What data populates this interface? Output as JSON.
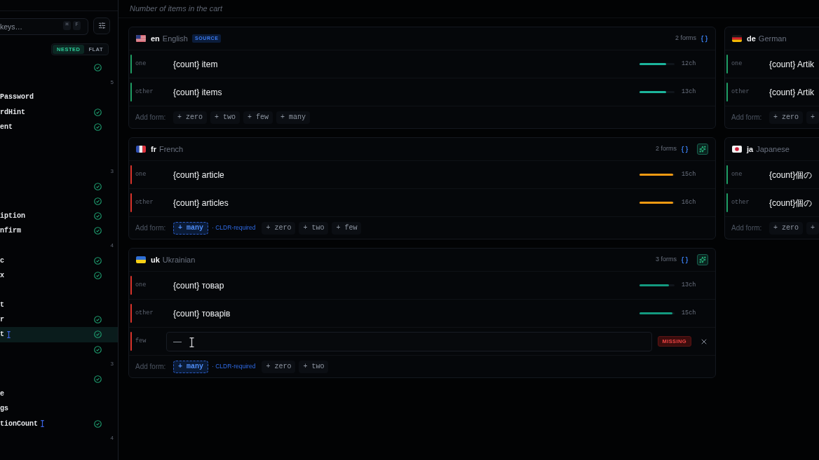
{
  "sidebar": {
    "search": {
      "placeholder": "keys…",
      "shortcut": [
        "⌘",
        "F"
      ]
    },
    "view_toggle": [
      {
        "label": "NESTED",
        "selected": true
      },
      {
        "label": "FLAT",
        "selected": false
      }
    ],
    "rows": [
      {
        "kind": "item",
        "selected": false,
        "translated": true
      },
      {
        "kind": "item",
        "count": "5",
        "selected": false,
        "translated": false
      },
      {
        "kind": "item",
        "label": "Password",
        "selected": false,
        "translated": false
      },
      {
        "kind": "item",
        "label": "rdHint",
        "selected": false,
        "translated": true
      },
      {
        "kind": "item",
        "label": "ent",
        "selected": false,
        "translated": true
      },
      {
        "kind": "blank"
      },
      {
        "kind": "blank"
      },
      {
        "kind": "item",
        "count": "3",
        "selected": false,
        "translated": false
      },
      {
        "kind": "item",
        "selected": false,
        "translated": true
      },
      {
        "kind": "item",
        "selected": false,
        "translated": true
      },
      {
        "kind": "item",
        "label": "iption",
        "selected": false,
        "translated": true
      },
      {
        "kind": "item",
        "label": "nfirm",
        "selected": false,
        "translated": true
      },
      {
        "kind": "item",
        "count": "4",
        "selected": false,
        "translated": false
      },
      {
        "kind": "item",
        "label": "c",
        "selected": false,
        "translated": true
      },
      {
        "kind": "item",
        "label": "x",
        "selected": false,
        "translated": true
      },
      {
        "kind": "blank"
      },
      {
        "kind": "item",
        "label": "t",
        "selected": false,
        "translated": false
      },
      {
        "kind": "item",
        "label": "r",
        "selected": false,
        "translated": true
      },
      {
        "kind": "item",
        "label": "t",
        "marker": true,
        "selected": true,
        "translated": true
      },
      {
        "kind": "item",
        "selected": false,
        "translated": true
      },
      {
        "kind": "item",
        "count": "3",
        "selected": false,
        "translated": false
      },
      {
        "kind": "item",
        "selected": false,
        "translated": true
      },
      {
        "kind": "item",
        "label": "e",
        "selected": false,
        "translated": false
      },
      {
        "kind": "item",
        "label": "gs",
        "selected": false,
        "translated": false
      },
      {
        "kind": "item",
        "label": "tionCount",
        "marker": true,
        "selected": false,
        "translated": true
      },
      {
        "kind": "item",
        "count": "4",
        "selected": false,
        "translated": false
      }
    ]
  },
  "description": "Number of items in the cart",
  "main_locales": [
    {
      "flag": {
        "kind": "us"
      },
      "code": "en",
      "name": "English",
      "badge": "SOURCE",
      "form_count": "2 forms",
      "ai_button": false,
      "complete": true,
      "forms": [
        {
          "kind": "filled",
          "label": "one",
          "value": "{count} item",
          "meter": {
            "level": 0.76,
            "color": "#1cb59c"
          },
          "length": "12ch"
        },
        {
          "kind": "filled",
          "label": "other",
          "value": "{count} items",
          "meter": {
            "level": 0.76,
            "color": "#1cb59c"
          },
          "length": "13ch"
        }
      ],
      "add_form": {
        "label": "Add form:",
        "options": [
          {
            "label": "+ zero",
            "required": false
          },
          {
            "label": "+ two",
            "required": false
          },
          {
            "label": "+ few",
            "required": false
          },
          {
            "label": "+ many",
            "required": false
          }
        ]
      }
    },
    {
      "flag": {
        "kind": "fr"
      },
      "code": "fr",
      "name": "French",
      "form_count": "2 forms",
      "ai_button": true,
      "complete": false,
      "forms": [
        {
          "kind": "filled",
          "label": "one",
          "value": "{count} article",
          "meter": {
            "level": 0.96,
            "color": "#f29a12"
          },
          "length": "15ch"
        },
        {
          "kind": "filled",
          "label": "other",
          "value": "{count} articles",
          "meter": {
            "level": 0.96,
            "color": "#f29a12"
          },
          "length": "16ch"
        }
      ],
      "add_form": {
        "label": "Add form:",
        "options": [
          {
            "label": "+ many",
            "required": true,
            "note": "· CLDR-required"
          },
          {
            "label": "+ zero",
            "required": false
          },
          {
            "label": "+ two",
            "required": false
          },
          {
            "label": "+ few",
            "required": false
          }
        ]
      }
    },
    {
      "flag": {
        "kind": "ua"
      },
      "code": "uk",
      "name": "Ukrainian",
      "form_count": "3 forms",
      "ai_button": true,
      "complete": false,
      "forms": [
        {
          "kind": "filled",
          "label": "one",
          "value": "{count} товар",
          "meter": {
            "level": 0.84,
            "color": "#13997f"
          },
          "length": "13ch"
        },
        {
          "kind": "filled",
          "label": "other",
          "value": "{count} товарів",
          "meter": {
            "level": 0.94,
            "color": "#13997f"
          },
          "length": "15ch"
        },
        {
          "kind": "missing",
          "label": "few",
          "placeholder": "—",
          "badge": "MISSING"
        }
      ],
      "add_form": {
        "label": "Add form:",
        "options": [
          {
            "label": "+ many",
            "required": true,
            "note": "· CLDR-required"
          },
          {
            "label": "+ zero",
            "required": false
          },
          {
            "label": "+ two",
            "required": false
          }
        ]
      }
    }
  ],
  "side_locales": [
    {
      "flag": {
        "kind": "de"
      },
      "code": "de",
      "name": "German",
      "ai_button": false,
      "complete": true,
      "forms": [
        {
          "kind": "filled",
          "label": "one",
          "value": "{count} Artik"
        },
        {
          "kind": "filled",
          "label": "other",
          "value": "{count} Artik"
        }
      ],
      "add_form": {
        "label": "Add form:",
        "options": [
          {
            "label": "+ zero",
            "required": false
          },
          {
            "label": "+",
            "required": false
          }
        ]
      }
    },
    {
      "flag": {
        "kind": "jp"
      },
      "code": "ja",
      "name": "Japanese",
      "ai_button": false,
      "complete": true,
      "forms": [
        {
          "kind": "filled",
          "label": "one",
          "value": "{count}個の"
        },
        {
          "kind": "filled",
          "label": "other",
          "value": "{count}個の"
        }
      ],
      "add_form": {
        "label": "Add form:",
        "options": [
          {
            "label": "+ zero",
            "required": false
          },
          {
            "label": "+",
            "required": false
          }
        ]
      }
    }
  ]
}
